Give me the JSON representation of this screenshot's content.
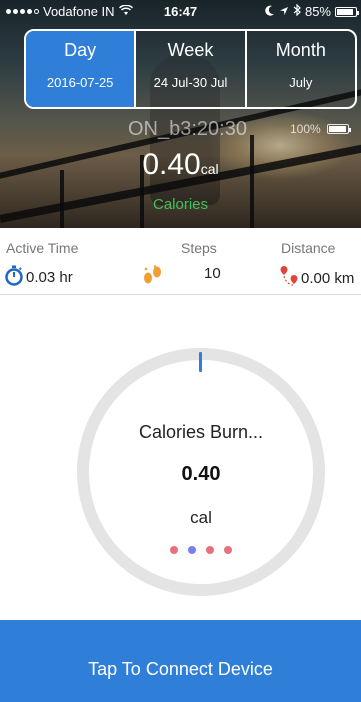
{
  "status_bar": {
    "carrier": "Vodafone IN",
    "time": "16:47",
    "battery_percent": "85%"
  },
  "period_tabs": [
    {
      "label": "Day",
      "sub": "2016-07-25",
      "active": true
    },
    {
      "label": "Week",
      "sub": "24 Jul-30 Jul",
      "active": false
    },
    {
      "label": "Month",
      "sub": "July",
      "active": false
    }
  ],
  "device": {
    "name": "ON_b3:20:30",
    "battery": "100%"
  },
  "summary": {
    "value": "0.40",
    "unit": "cal",
    "label": "Calories"
  },
  "stats": {
    "active_time": {
      "label": "Active Time",
      "value": "0.03 hr",
      "icon": "stopwatch-icon"
    },
    "steps": {
      "label": "Steps",
      "value": "10",
      "icon": "footprints-icon"
    },
    "distance": {
      "label": "Distance",
      "value": "0.00 km",
      "icon": "route-pin-icon"
    }
  },
  "ring": {
    "title": "Calories Burn...",
    "value": "0.40",
    "unit": "cal",
    "progress_fraction": 0.0,
    "page_dots": [
      "#e8707a",
      "#7a7ef0",
      "#e8707a",
      "#e8707a"
    ]
  },
  "colors": {
    "accent": "#2f7fd8",
    "calories_green": "#3fc35a"
  },
  "connect_button": {
    "label": "Tap To Connect Device"
  }
}
